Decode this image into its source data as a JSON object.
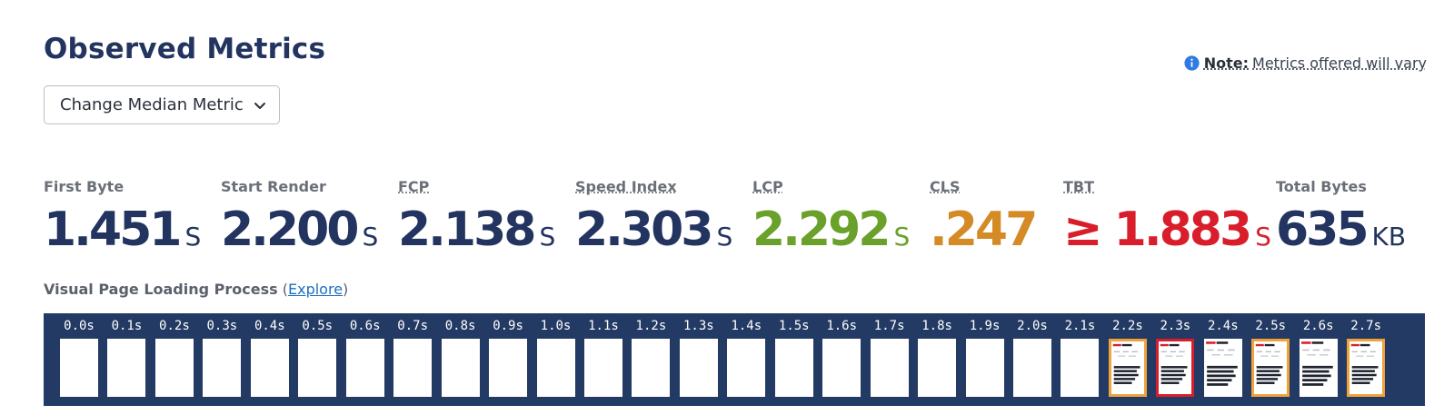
{
  "header": {
    "title": "Observed Metrics",
    "median_button_label": "Change Median Metric",
    "note_label": "Note:",
    "note_text": "Metrics offered will vary"
  },
  "metrics": [
    {
      "label": "First Byte",
      "value": "1.451",
      "unit": "S",
      "color": "#22345f"
    },
    {
      "label": "Start Render",
      "value": "2.200",
      "unit": "S",
      "color": "#22345f"
    },
    {
      "label": "FCP",
      "value": "2.138",
      "unit": "S",
      "color": "#22345f"
    },
    {
      "label": "Speed Index",
      "value": "2.303",
      "unit": "S",
      "color": "#22345f"
    },
    {
      "label": "LCP",
      "value": "2.292",
      "unit": "S",
      "color": "#6aa12a"
    },
    {
      "label": "CLS",
      "value": ".247",
      "unit": "",
      "color": "#d48a25"
    },
    {
      "label": "TBT",
      "value": "≥ 1.883",
      "unit": "S",
      "color": "#d91e2b"
    },
    {
      "label": "Total Bytes",
      "value": "635",
      "unit": "KB",
      "color": "#22345f"
    }
  ],
  "visual_loading": {
    "label": "Visual Page Loading Process",
    "link_label": "Explore"
  },
  "filmstrip": {
    "frames": [
      {
        "time": "0.0s",
        "state": "blank"
      },
      {
        "time": "0.1s",
        "state": "blank"
      },
      {
        "time": "0.2s",
        "state": "blank"
      },
      {
        "time": "0.3s",
        "state": "blank"
      },
      {
        "time": "0.4s",
        "state": "blank"
      },
      {
        "time": "0.5s",
        "state": "blank"
      },
      {
        "time": "0.6s",
        "state": "blank"
      },
      {
        "time": "0.7s",
        "state": "blank"
      },
      {
        "time": "0.8s",
        "state": "blank"
      },
      {
        "time": "0.9s",
        "state": "blank"
      },
      {
        "time": "1.0s",
        "state": "blank"
      },
      {
        "time": "1.1s",
        "state": "blank"
      },
      {
        "time": "1.2s",
        "state": "blank"
      },
      {
        "time": "1.3s",
        "state": "blank"
      },
      {
        "time": "1.4s",
        "state": "blank"
      },
      {
        "time": "1.5s",
        "state": "blank"
      },
      {
        "time": "1.6s",
        "state": "blank"
      },
      {
        "time": "1.7s",
        "state": "blank"
      },
      {
        "time": "1.8s",
        "state": "blank"
      },
      {
        "time": "1.9s",
        "state": "blank"
      },
      {
        "time": "2.0s",
        "state": "blank"
      },
      {
        "time": "2.1s",
        "state": "blank"
      },
      {
        "time": "2.2s",
        "state": "changed"
      },
      {
        "time": "2.3s",
        "state": "lcp"
      },
      {
        "time": "2.4s",
        "state": "same"
      },
      {
        "time": "2.5s",
        "state": "changed"
      },
      {
        "time": "2.6s",
        "state": "same"
      },
      {
        "time": "2.7s",
        "state": "changed"
      }
    ]
  },
  "colors": {
    "filmstrip_bg": "#233a64",
    "changed_border": "#f0a23b",
    "lcp_border": "#d91e2b",
    "link": "#1a6fc0"
  }
}
